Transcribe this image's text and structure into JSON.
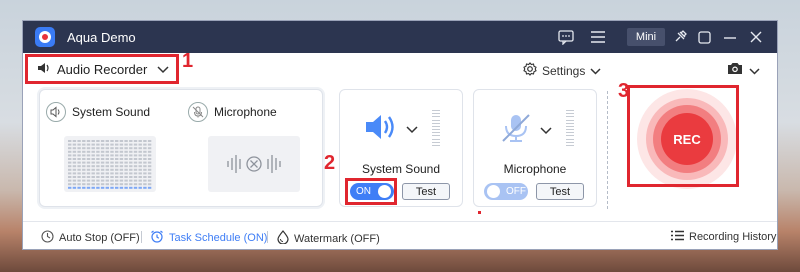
{
  "window": {
    "title": "Aqua Demo",
    "mini_label": "Mini"
  },
  "toolbar": {
    "source": "Audio Recorder",
    "settings": "Settings"
  },
  "annotations": [
    "1",
    "2",
    "3"
  ],
  "preview": {
    "system_sound": "System Sound",
    "microphone": "Microphone"
  },
  "sources": {
    "system": {
      "name": "System Sound",
      "toggle": "ON",
      "test": "Test"
    },
    "mic": {
      "name": "Microphone",
      "toggle": "OFF",
      "test": "Test"
    }
  },
  "record": {
    "label": "REC"
  },
  "bottom": {
    "auto_stop": "Auto Stop (OFF)",
    "task_schedule": "Task Schedule (ON)",
    "watermark": "Watermark (OFF)",
    "history": "Recording History"
  },
  "colors": {
    "titlebar": "#2c3550",
    "accent": "#3f7ef6",
    "rec": "#ea3b3f",
    "highlight": "#e0262f"
  }
}
